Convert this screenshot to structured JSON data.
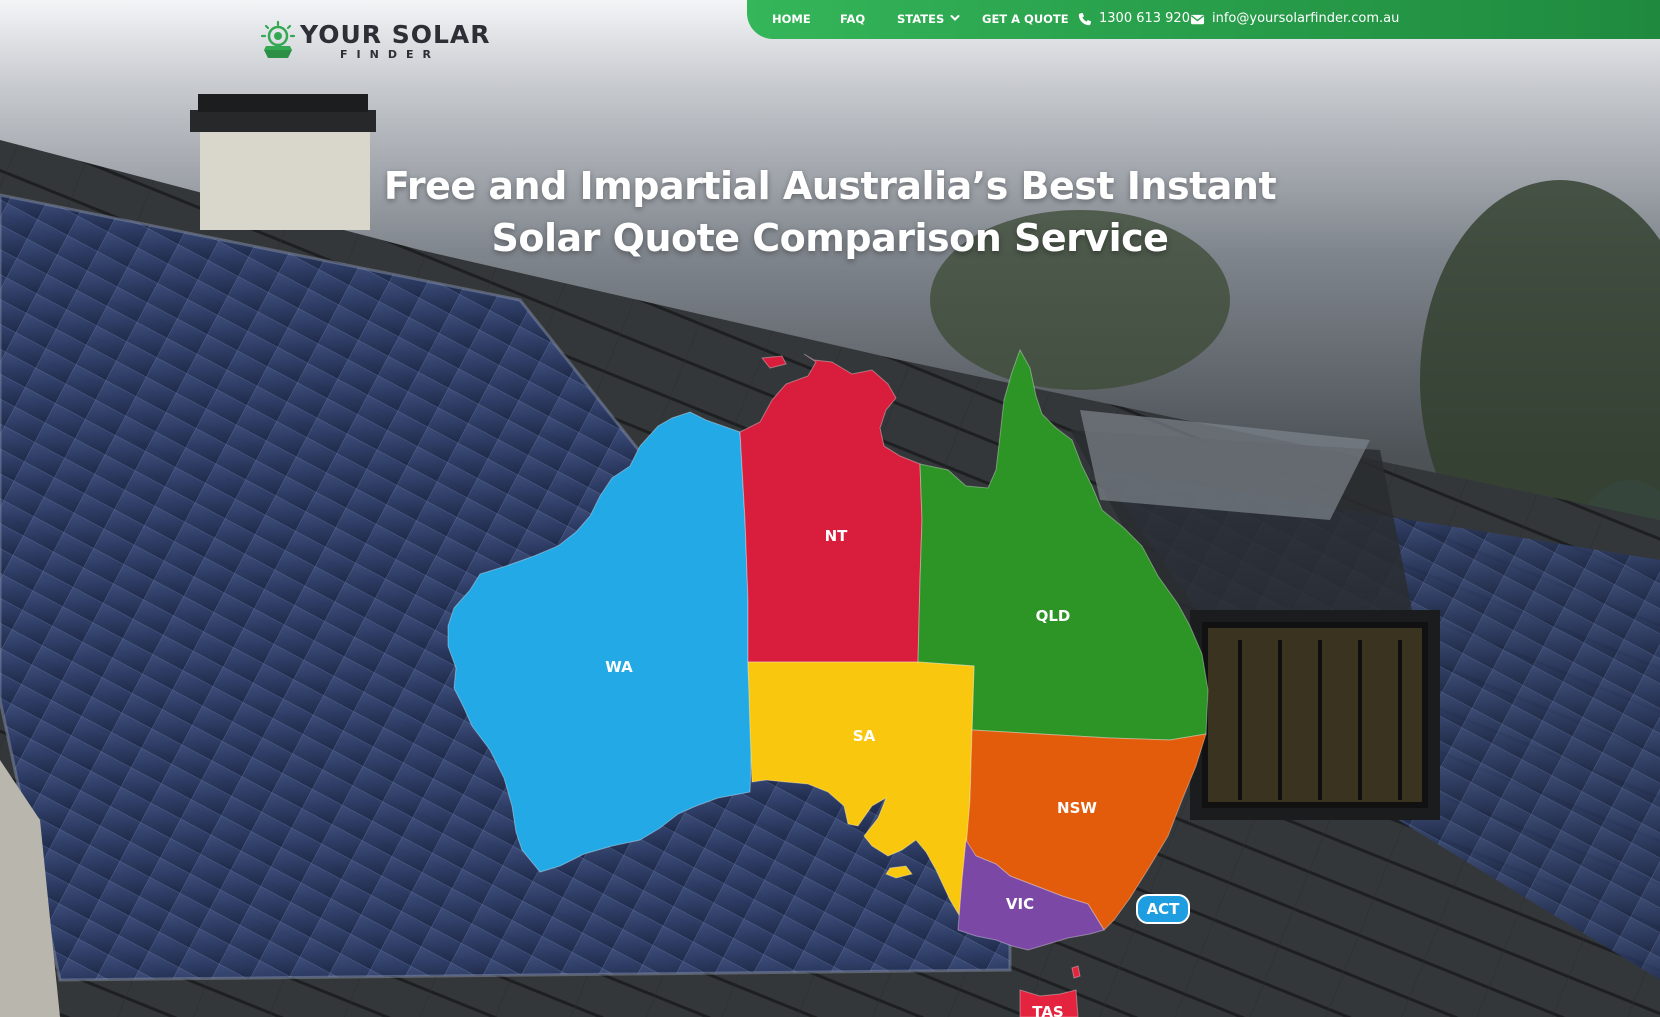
{
  "brand": {
    "name": "YOUR SOLAR",
    "tagline": "FINDER",
    "logo_icon": "solar-sun-icon"
  },
  "nav": {
    "items": [
      {
        "label": "HOME"
      },
      {
        "label": "FAQ"
      },
      {
        "label": "STATES",
        "has_dropdown": true
      },
      {
        "label": "GET A QUOTE"
      }
    ],
    "phone": "1300 613 920",
    "phone_icon": "phone-icon",
    "email": "info@yoursolarfinder.com.au",
    "email_icon": "envelope-icon"
  },
  "hero": {
    "title": "Free and Impartial Australia’s Best Instant Solar Quote Comparison Service"
  },
  "map": {
    "regions": [
      {
        "code": "WA",
        "color": "#22a9e6"
      },
      {
        "code": "NT",
        "color": "#d81e3c"
      },
      {
        "code": "QLD",
        "color": "#2d9426"
      },
      {
        "code": "SA",
        "color": "#f9c80e"
      },
      {
        "code": "NSW",
        "color": "#e25c0c"
      },
      {
        "code": "VIC",
        "color": "#7b48a6"
      },
      {
        "code": "ACT",
        "color": "#1e9de0"
      },
      {
        "code": "TAS",
        "color": "#e4233e"
      }
    ]
  },
  "colors": {
    "nav_green": "#2aa24d",
    "title_text": "#ffffff"
  }
}
